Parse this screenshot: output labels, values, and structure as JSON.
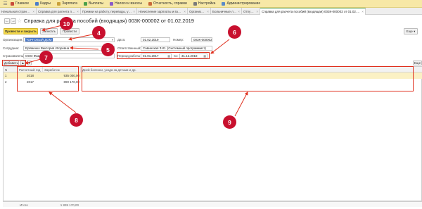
{
  "topmenu": {
    "items": [
      {
        "label": "Главное",
        "color": "#c94a3a"
      },
      {
        "label": "Кадры",
        "color": "#4a7cc9"
      },
      {
        "label": "Зарплата",
        "color": "#c9a03a"
      },
      {
        "label": "Выплаты",
        "color": "#4aa04a"
      },
      {
        "label": "Налоги и взносы",
        "color": "#8a5ac9"
      },
      {
        "label": "Отчетность, справки",
        "color": "#c96a3a"
      },
      {
        "label": "Настройка",
        "color": "#7a7a7a"
      },
      {
        "label": "Администрирование",
        "color": "#5a8ac9"
      }
    ]
  },
  "tabs": [
    {
      "label": "Начальная страница",
      "width": 52,
      "active": false
    },
    {
      "label": "Справка для расчета пособий",
      "width": 63,
      "active": false
    },
    {
      "label": "Премии на работу, переводы, увольнения",
      "width": 80,
      "active": false
    },
    {
      "label": "Начисление зарплаты и взносов",
      "width": 72,
      "active": false
    },
    {
      "label": "Организация",
      "width": 33,
      "active": false
    },
    {
      "label": "Больничные листы",
      "width": 44,
      "active": false
    },
    {
      "label": "Отпуска",
      "width": 26,
      "active": false
    },
    {
      "label": "Справка для расчета пособий (входящая) 003К-000002 от 01.02.2019",
      "width": 150,
      "active": true
    }
  ],
  "title": "Справка для расчета пособий (входящая) 003К-000002 от 01.02.2019",
  "toolbar": {
    "post_close": "Провести и закрыть",
    "save": "Записать",
    "post": "Провести",
    "more": "Еще"
  },
  "form": {
    "org_label": "Организация:",
    "org_value": "ТОРГОВЫЙ ДОМ",
    "date_label": "Дата:",
    "date_value": "01.02.2019",
    "number_label": "Номер:",
    "number_value": "003К-000002",
    "employee_label": "Сотрудник:",
    "employee_value": "Ерёменко Виктория Игоревна",
    "responsible_label": "Ответственный:",
    "responsible_value": "Савинская З.Ю. (Системный программист)",
    "insurer_label": "Страхователь:",
    "insurer_value": "ООО Фиалка",
    "period_label": "Период работы с:",
    "period_from": "01.01.2017",
    "period_to_label": "по:",
    "period_to": "31.12.2018"
  },
  "table": {
    "add_button": "Добавить",
    "columns": {
      "n": "N",
      "year": "Расчетный год",
      "earnings": "Заработок",
      "sick_days": "Дней болезни, ухода за детьми и др."
    },
    "rows": [
      {
        "n": "1",
        "year": "2018",
        "earnings": "935 000,00",
        "selected": true
      },
      {
        "n": "2",
        "year": "2017",
        "earnings": "890 170,00",
        "selected": false
      }
    ],
    "footer_label": "Итого",
    "footer_total": "1 835 170,00"
  },
  "annotations": {
    "b4": "4",
    "b5": "5",
    "b6": "6",
    "b7": "7",
    "b8": "8",
    "b9": "9",
    "b10": "10",
    "color": "#c8102e"
  }
}
